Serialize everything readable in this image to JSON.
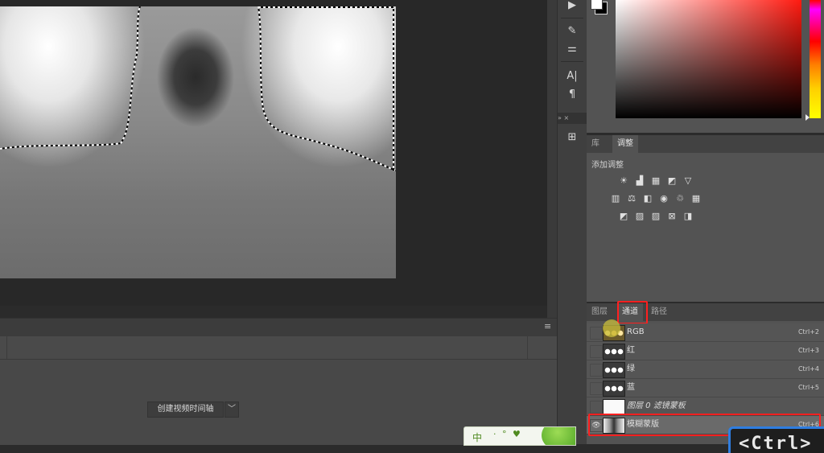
{
  "tool_strip": {
    "icons": [
      "play-icon",
      "brush-icon",
      "sliders-icon",
      "character-icon",
      "paragraph-icon"
    ],
    "glyphs": [
      "▶",
      "✎",
      "⚌",
      "A|",
      "¶"
    ],
    "mini_header_glyphs": "»  ×",
    "panel_icon_glyph": "⊞"
  },
  "colors": {
    "foreground": "#ffffff",
    "background": "#000000",
    "hue": "#ff1a10"
  },
  "adjustments": {
    "tabs": [
      "库",
      "调整"
    ],
    "active_tab": "调整",
    "title": "添加调整",
    "row1": [
      "☀",
      "▟",
      "▦",
      "◩",
      "▽"
    ],
    "row2": [
      "▥",
      "⚖",
      "◧",
      "◉",
      "♲",
      "▦"
    ],
    "row3": [
      "◩",
      "▨",
      "▨",
      "⊠",
      "◨"
    ]
  },
  "channels_panel": {
    "tabs": [
      "图层",
      "通道",
      "路径"
    ],
    "active_tab": "通道",
    "rows": [
      {
        "name": "RGB",
        "shortcut": "Ctrl+2"
      },
      {
        "name": "红",
        "shortcut": "Ctrl+3"
      },
      {
        "name": "绿",
        "shortcut": "Ctrl+4"
      },
      {
        "name": "蓝",
        "shortcut": "Ctrl+5"
      },
      {
        "name": "图层 0 滤镜蒙板",
        "shortcut": ""
      },
      {
        "name": "模糊蒙版",
        "shortcut": "Ctrl+6"
      }
    ],
    "eye_glyph": "👁"
  },
  "timeline": {
    "create_button": "创建视频时间轴",
    "dropdown_glyph": "﹀",
    "menu_glyph": "≡"
  },
  "overlays": {
    "ime_label": "中",
    "ime_dots": "·  °  ♥",
    "ctrl_key": "<Ctrl>"
  }
}
